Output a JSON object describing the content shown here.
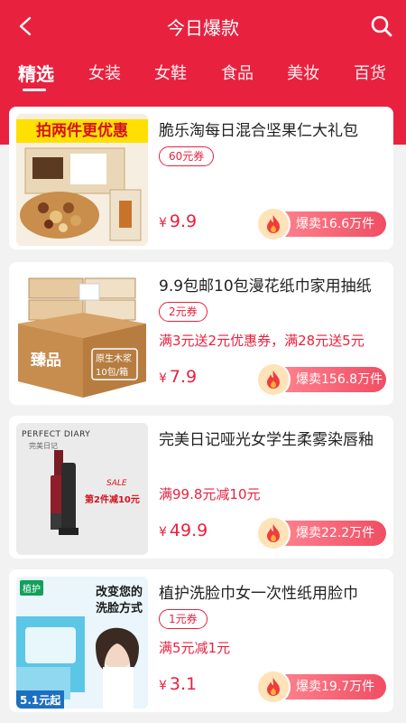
{
  "header": {
    "title": "今日爆款",
    "back_icon": "chevron-left-icon",
    "search_icon": "search-icon",
    "accent_color": "#e8213f"
  },
  "tabs": [
    "精选",
    "女装",
    "女鞋",
    "食品",
    "美妆",
    "百货"
  ],
  "active_tab": "精选",
  "products": [
    {
      "title": "脆乐淘每日混合坚果仁大礼包",
      "coupon": "60元券",
      "promo": "",
      "currency": "¥",
      "price": "9.9",
      "sold": "爆卖16.6万件",
      "image_banner": "拍两件更优惠"
    },
    {
      "title": "9.9包邮10包漫花纸巾家用抽纸",
      "coupon": "2元券",
      "promo": "满3元送2元优惠券，满28元送5元",
      "currency": "¥",
      "price": "7.9",
      "sold": "爆卖156.8万件"
    },
    {
      "title": "完美日记哑光女学生柔雾染唇釉",
      "coupon": "",
      "promo": "满99.8元减10元",
      "currency": "¥",
      "price": "49.9",
      "sold": "爆卖22.2万件",
      "image_brand": "PERFECT DIARY",
      "image_brand_cn": "完美日记",
      "image_sale_tag": "SALE",
      "image_sale_text": "第2件减10元"
    },
    {
      "title": "植护洗脸巾女一次性纸用脸巾",
      "coupon": "1元券",
      "promo": "满5元减1元",
      "currency": "¥",
      "price": "3.1",
      "sold": "爆卖19.7万件",
      "image_brand": "植护",
      "image_slogan_1": "改变您的",
      "image_slogan_2": "洗脸方式",
      "image_badge": "5.1元起"
    }
  ]
}
